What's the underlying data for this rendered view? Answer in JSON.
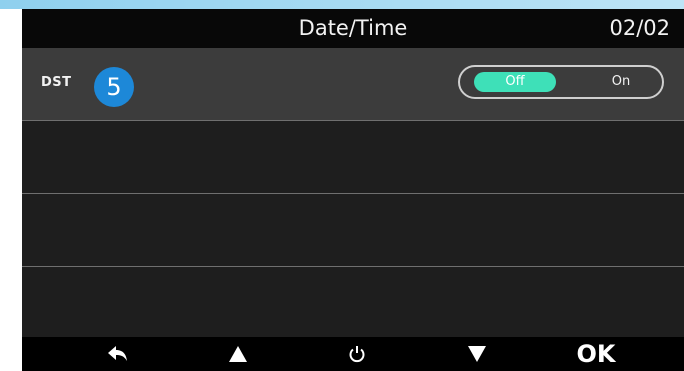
{
  "header": {
    "title": "Date/Time",
    "page_indicator": "02/02"
  },
  "settings": [
    {
      "label": "DST",
      "badge": "5",
      "toggle": {
        "options": [
          "Off",
          "On"
        ],
        "selected": "Off"
      }
    }
  ],
  "footer": {
    "keys": [
      {
        "icon": "back-arrow-icon"
      },
      {
        "icon": "up-arrow-icon"
      },
      {
        "icon": "power-icon"
      },
      {
        "icon": "down-arrow-icon"
      },
      {
        "label": "OK"
      }
    ]
  },
  "colors": {
    "header_bg": "#080808",
    "selected_row_bg": "#3c3c3c",
    "toggle_active": "#3ee0b8",
    "badge": "#1d88d8",
    "top_strip": "#8fd0ee"
  }
}
